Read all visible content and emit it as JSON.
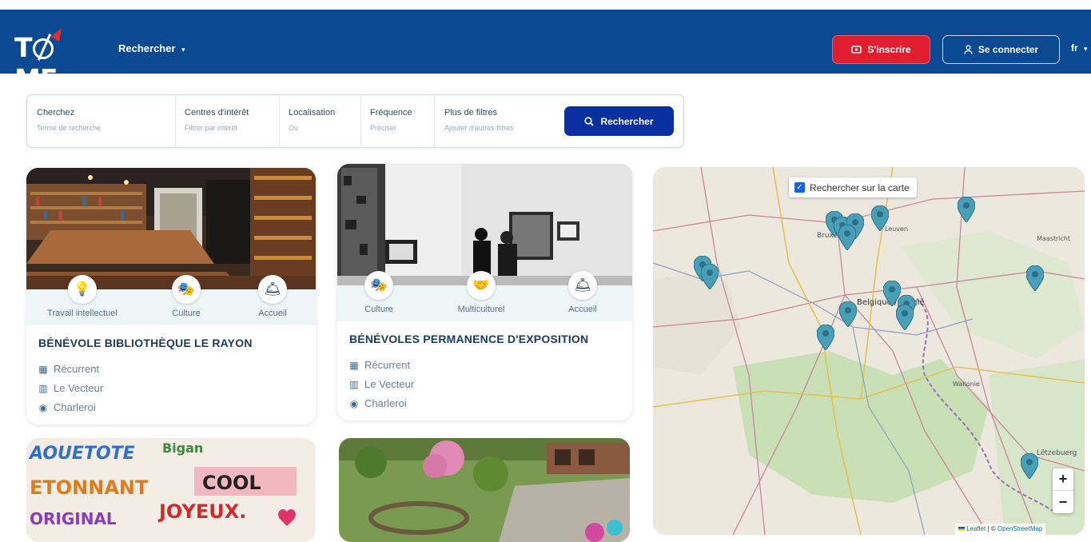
{
  "header": {
    "logo_text": "TIME",
    "nav_search": "Rechercher",
    "signup_label": "S'inscrire",
    "login_label": "Se connecter",
    "language": "fr",
    "colors": {
      "bar": "#0b4a93",
      "signup": "#e11d30"
    }
  },
  "search": {
    "fields": [
      {
        "label": "Cherchez",
        "placeholder": "Terme de recherche"
      },
      {
        "label": "Centres d'intérêt",
        "placeholder": "Filtrer par intérêt"
      },
      {
        "label": "Localisation",
        "placeholder": "Où"
      },
      {
        "label": "Fréquence",
        "placeholder": "Préciser"
      },
      {
        "label": "Plus de filtres",
        "placeholder": "Ajouter d'autres filtres"
      }
    ],
    "button_label": "Rechercher"
  },
  "cards": [
    {
      "title": "BÉNÉVOLE BIBLIOTHÈQUE LE RAYON",
      "tags": [
        {
          "label": "Travail intellectuel",
          "icon": "lamp-icon"
        },
        {
          "label": "Culture",
          "icon": "theater-masks-icon"
        },
        {
          "label": "Accueil",
          "icon": "reception-desk-icon"
        }
      ],
      "frequency": "Récurrent",
      "organization": "Le Vecteur",
      "location": "Charleroi"
    },
    {
      "title": "BÉNÉVOLES PERMANENCE D'EXPOSITION",
      "tags": [
        {
          "label": "Culture",
          "icon": "theater-masks-icon"
        },
        {
          "label": "Multiculturel",
          "icon": "multicultural-icon"
        },
        {
          "label": "Accueil",
          "icon": "reception-desk-icon"
        }
      ],
      "frequency": "Récurrent",
      "organization": "Le Vecteur",
      "location": "Charleroi"
    }
  ],
  "map": {
    "search_on_map_label": "Rechercher sur la carte",
    "zoom_in": "+",
    "zoom_out": "−",
    "attribution_leaflet": "Leaflet",
    "attribution_sep": " | © ",
    "attribution_osm": "OpenStreetMap",
    "places": [
      "Bruxelles",
      "Leuven",
      "Maastricht",
      "Belgique",
      "Wallonie",
      "Lëtzebuerg"
    ],
    "marker_color": "#4a9fb8"
  }
}
